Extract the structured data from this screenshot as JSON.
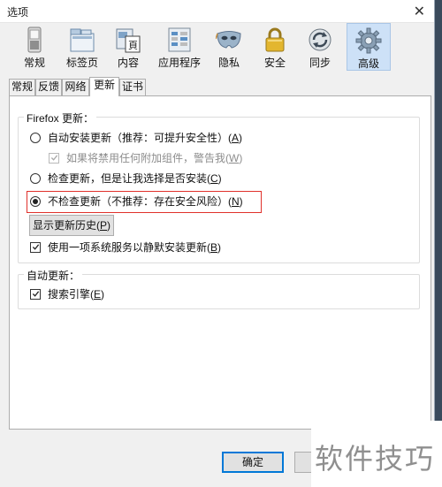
{
  "window": {
    "title": "选项",
    "close_glyph": "✕"
  },
  "toolbar": {
    "panes": [
      {
        "label": "常规",
        "icon": "switch-icon"
      },
      {
        "label": "标签页",
        "icon": "tabs-icon"
      },
      {
        "label": "内容",
        "icon": "page-icon"
      },
      {
        "label": "应用程序",
        "icon": "applications-icon"
      },
      {
        "label": "隐私",
        "icon": "mask-icon"
      },
      {
        "label": "安全",
        "icon": "lock-icon"
      },
      {
        "label": "同步",
        "icon": "sync-icon"
      },
      {
        "label": "高级",
        "icon": "gear-icon",
        "selected": true
      }
    ]
  },
  "tabs": [
    {
      "label": "常规"
    },
    {
      "label": "反馈"
    },
    {
      "label": "网络"
    },
    {
      "label": "更新",
      "active": true
    },
    {
      "label": "证书"
    }
  ],
  "update_group": {
    "legend": "Firefox 更新：",
    "auto_install": {
      "text": "自动安装更新（推荐：可提升安全性）(",
      "key": "A",
      "tail": ")",
      "checked": false
    },
    "warn_addons": {
      "text": "如果将禁用任何附加组件，警告我(",
      "key": "W",
      "tail": ")",
      "checked": true,
      "disabled": true
    },
    "check_choose": {
      "text": "检查更新，但是让我选择是否安装(",
      "key": "C",
      "tail": ")",
      "checked": false
    },
    "never_check": {
      "text": "不检查更新（不推荐：存在安全风险）(",
      "key": "N",
      "tail": ")",
      "checked": true
    },
    "history_button": {
      "text": "显示更新历史(",
      "key": "P",
      "tail": ")"
    },
    "background_service": {
      "text": "使用一项系统服务以静默安装更新(",
      "key": "B",
      "tail": ")",
      "checked": true
    }
  },
  "auto_update_group": {
    "legend": "自动更新：",
    "search_engines": {
      "text": "搜索引擎(",
      "key": "E",
      "tail": ")",
      "checked": true
    }
  },
  "footer": {
    "ok_label": "确定"
  },
  "watermark": {
    "text": "软件技巧"
  },
  "colors": {
    "highlight_border": "#e0312b",
    "selected_pane": "#cde1f7",
    "primary_button": "#0078d7"
  }
}
